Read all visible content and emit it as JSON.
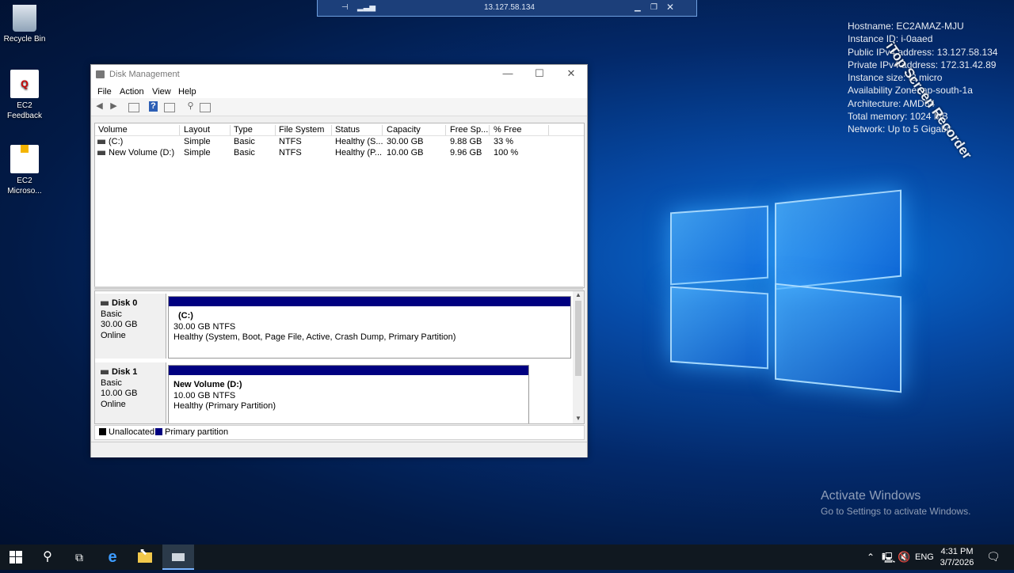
{
  "desktop": {
    "icons": [
      {
        "label": "Recycle Bin",
        "icon": "recycle-bin-icon"
      },
      {
        "label": "EC2\nFeedback",
        "icon": "feedback-icon"
      },
      {
        "label": "EC2\nMicroso...",
        "icon": "ec2-launch-icon"
      }
    ],
    "activate": {
      "title": "Activate Windows",
      "subtitle": "Go to Settings to activate Windows."
    },
    "watermark": "iTop Screen Recorder"
  },
  "rdp_bar": {
    "ip": "13.127.58.134"
  },
  "instance_info": [
    "Hostname: EC2AMAZ-MJU",
    "Instance ID: i-0aaed",
    "Public IPv4 address: 13.127.58.134",
    "Private IPv4 address: 172.31.42.89",
    "Instance size: t3.micro",
    "Availability Zone: ap-south-1a",
    "Architecture: AMD64",
    "Total memory: 1024 MB",
    "Network: Up to 5 Gigabit"
  ],
  "window": {
    "title": "Disk Management",
    "menu": [
      "File",
      "Action",
      "View",
      "Help"
    ],
    "columns": [
      "Volume",
      "Layout",
      "Type",
      "File System",
      "Status",
      "Capacity",
      "Free Sp...",
      "% Free"
    ],
    "volumes": [
      {
        "volume": "(C:)",
        "layout": "Simple",
        "type": "Basic",
        "fs": "NTFS",
        "status": "Healthy (S...",
        "capacity": "30.00 GB",
        "free": "9.88 GB",
        "pct": "33 %"
      },
      {
        "volume": "New Volume (D:)",
        "layout": "Simple",
        "type": "Basic",
        "fs": "NTFS",
        "status": "Healthy (P...",
        "capacity": "10.00 GB",
        "free": "9.96 GB",
        "pct": "100 %"
      }
    ],
    "disks": [
      {
        "name": "Disk 0",
        "type": "Basic",
        "size": "30.00 GB",
        "state": "Online",
        "partition": {
          "name": "(C:)",
          "size": "30.00 GB NTFS",
          "status": "Healthy (System, Boot, Page File, Active, Crash Dump, Primary Partition)"
        }
      },
      {
        "name": "Disk 1",
        "type": "Basic",
        "size": "10.00 GB",
        "state": "Online",
        "partition": {
          "name": "New Volume  (D:)",
          "size": "10.00 GB NTFS",
          "status": "Healthy (Primary Partition)"
        }
      }
    ],
    "legend": {
      "unallocated": "Unallocated",
      "primary": "Primary partition"
    }
  },
  "taskbar": {
    "lang": "ENG",
    "time": "4:31 PM",
    "date": "3/7/2026"
  },
  "colors": {
    "partition_bar": "#000080",
    "taskbar": "#101820"
  }
}
